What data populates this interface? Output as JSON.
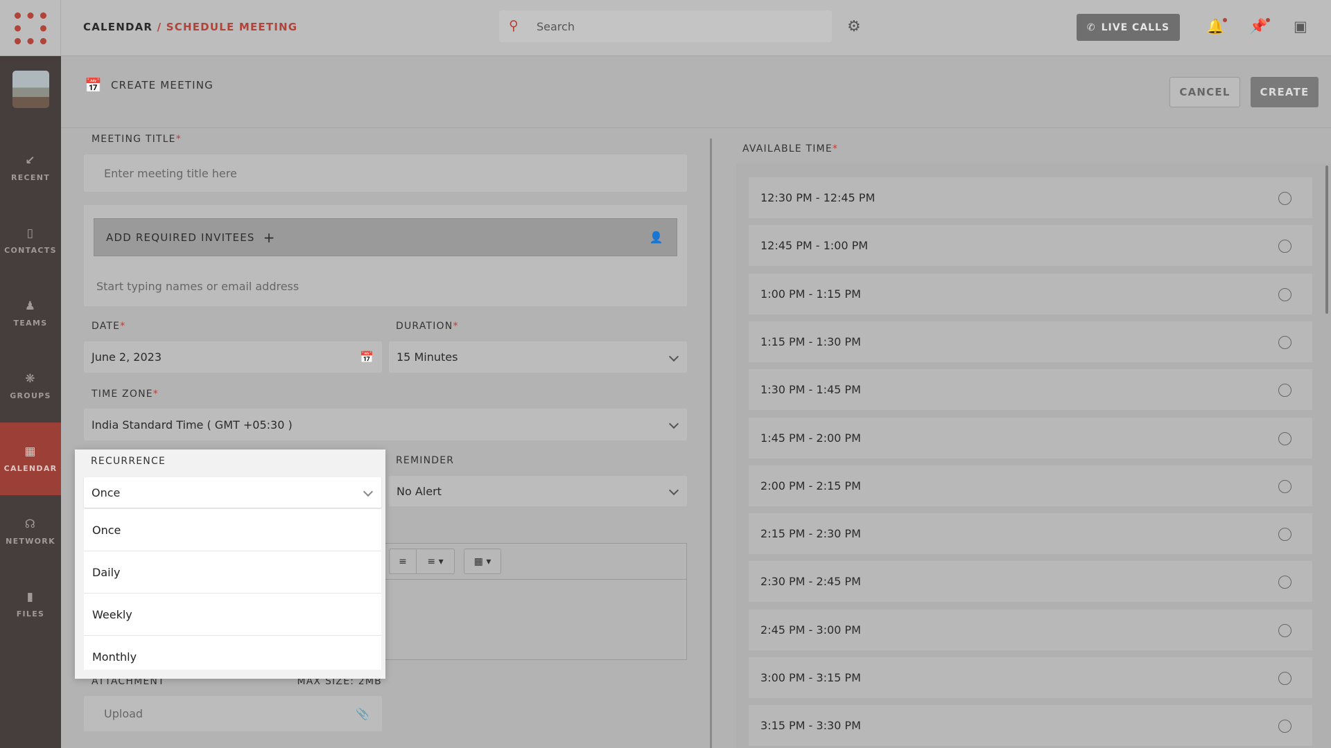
{
  "breadcrumb": {
    "parent": "CALENDAR",
    "separator": "/",
    "current": "SCHEDULE MEETING"
  },
  "search": {
    "placeholder": "Search",
    "icon": "search-icon"
  },
  "topbar": {
    "live_calls": "LIVE CALLS"
  },
  "sidebar": {
    "items": [
      {
        "label": "RECENT",
        "icon": "arrow-icon"
      },
      {
        "label": "CONTACTS",
        "icon": "contacts-icon"
      },
      {
        "label": "TEAMS",
        "icon": "teams-icon"
      },
      {
        "label": "GROUPS",
        "icon": "groups-icon"
      },
      {
        "label": "CALENDAR",
        "icon": "calendar-icon",
        "active": true
      },
      {
        "label": "NETWORK",
        "icon": "network-icon"
      },
      {
        "label": "FILES",
        "icon": "folder-icon"
      }
    ]
  },
  "header": {
    "title": "CREATE MEETING",
    "cancel": "CANCEL",
    "create": "CREATE"
  },
  "form": {
    "meeting_title": {
      "label": "MEETING TITLE",
      "required": "*",
      "placeholder": "Enter meeting title here"
    },
    "invitees": {
      "label": "ADD REQUIRED INVITEES",
      "plus": "+",
      "placeholder": "Start typing names or email address"
    },
    "date": {
      "label": "DATE",
      "required": "*",
      "value": "June 2, 2023"
    },
    "duration": {
      "label": "DURATION",
      "required": "*",
      "value": "15 Minutes"
    },
    "timezone": {
      "label": "TIME ZONE",
      "required": "*",
      "value": "India Standard Time ( GMT +05:30 )"
    },
    "recurrence": {
      "label": "RECURRENCE",
      "value": "Once",
      "options": [
        "Once",
        "Daily",
        "Weekly",
        "Monthly"
      ]
    },
    "reminder": {
      "label": "REMINDER",
      "value": "No Alert"
    },
    "attachment": {
      "label": "ATTACHMENT",
      "max_size": "MAX SIZE: 2MB",
      "placeholder": "Upload"
    }
  },
  "available_time": {
    "label": "AVAILABLE TIME",
    "required": "*",
    "slots": [
      "12:30 PM - 12:45 PM",
      "12:45 PM - 1:00 PM",
      "1:00 PM - 1:15 PM",
      "1:15 PM - 1:30 PM",
      "1:30 PM - 1:45 PM",
      "1:45 PM - 2:00 PM",
      "2:00 PM - 2:15 PM",
      "2:15 PM - 2:30 PM",
      "2:30 PM - 2:45 PM",
      "2:45 PM - 3:00 PM",
      "3:00 PM - 3:15 PM",
      "3:15 PM - 3:30 PM"
    ]
  },
  "colors": {
    "accent": "#b0433a",
    "sidebar": "#463e3d"
  }
}
